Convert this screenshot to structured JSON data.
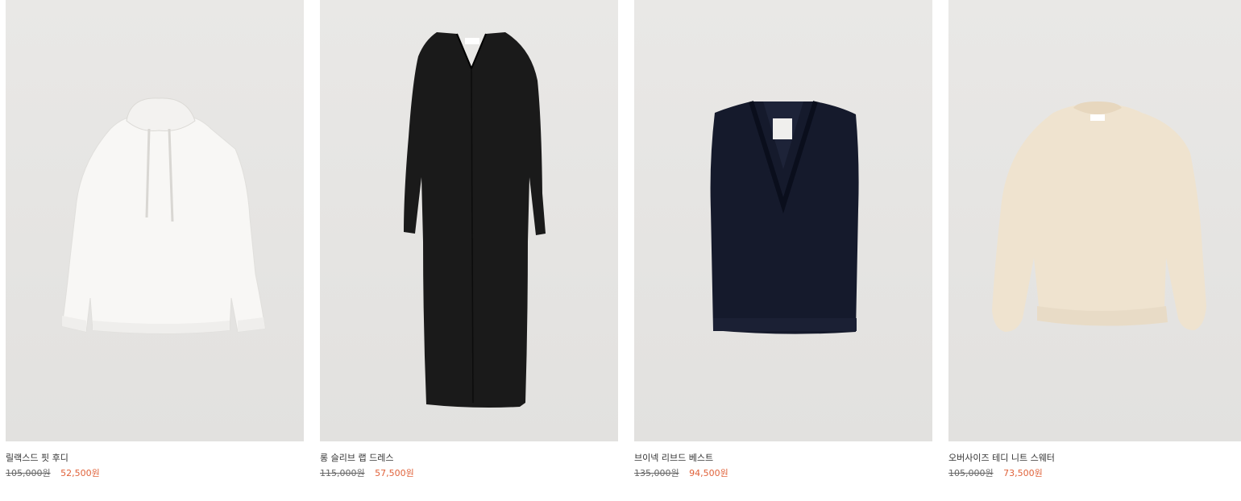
{
  "colors": {
    "sale_price": "#e0623a",
    "image_bg": "#e6e5e3"
  },
  "products": [
    {
      "name": "릴랙스드 핏 후디",
      "original_price": "105,000원",
      "sale_price": "52,500원",
      "image_icon": "white-hoodie"
    },
    {
      "name": "롱 슬리브 랩 드레스",
      "original_price": "115,000원",
      "sale_price": "57,500원",
      "image_icon": "black-long-dress"
    },
    {
      "name": "브이넥 리브드 베스트",
      "original_price": "135,000원",
      "sale_price": "94,500원",
      "image_icon": "navy-knit-vest"
    },
    {
      "name": "오버사이즈 테디 니트 스웨터",
      "original_price": "105,000원",
      "sale_price": "73,500원",
      "image_icon": "cream-teddy-sweater"
    }
  ]
}
